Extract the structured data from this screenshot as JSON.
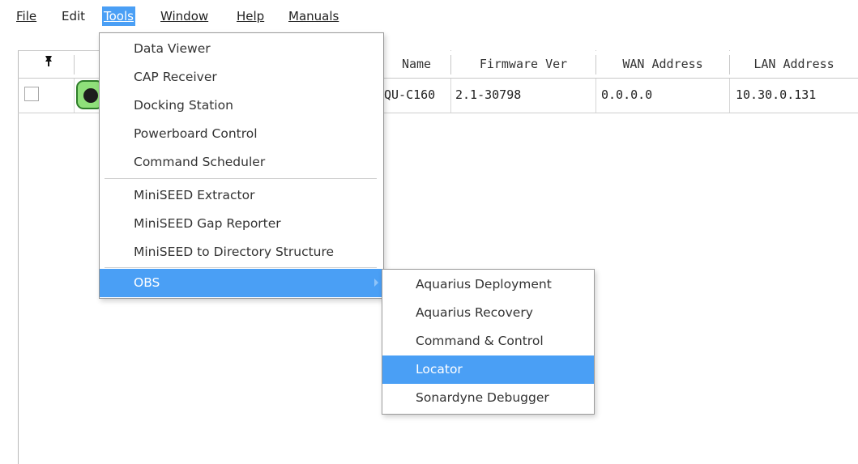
{
  "menubar": {
    "items": [
      "File",
      "Edit",
      "Tools",
      "Window",
      "Help",
      "Manuals"
    ]
  },
  "table": {
    "headers": [
      "Name",
      "Firmware Ver",
      "WAN Address",
      "LAN Address"
    ],
    "row": {
      "name": "QU-C160",
      "firmware": "2.1-30798",
      "wan": "0.0.0.0",
      "lan": "10.30.0.131",
      "checked": false,
      "status": "online"
    }
  },
  "tools_menu": {
    "items": [
      "Data Viewer",
      "CAP Receiver",
      "Docking Station",
      "Powerboard Control",
      "Command Scheduler",
      "MiniSEED Extractor",
      "MiniSEED Gap Reporter",
      "MiniSEED to Directory Structure",
      "OBS"
    ],
    "highlighted": "OBS"
  },
  "obs_submenu": {
    "items": [
      "Aquarius Deployment",
      "Aquarius Recovery",
      "Command & Control",
      "Locator",
      "Sonardyne Debugger"
    ],
    "highlighted": "Locator"
  },
  "colors": {
    "highlight": "#4a9ff5",
    "status_green": "#8fe07a"
  }
}
